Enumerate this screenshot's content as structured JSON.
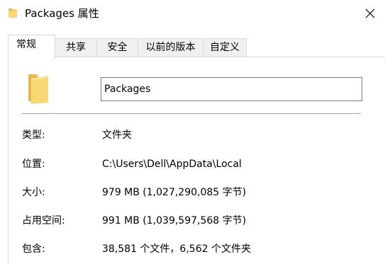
{
  "window": {
    "title": "Packages 属性",
    "close_glyph": "✕"
  },
  "tabs": [
    {
      "label": "常规",
      "active": true
    },
    {
      "label": "共享",
      "active": false
    },
    {
      "label": "安全",
      "active": false
    },
    {
      "label": "以前的版本",
      "active": false
    },
    {
      "label": "自定义",
      "active": false
    }
  ],
  "general": {
    "folder_name": "Packages",
    "type_label": "类型:",
    "type_value": "文件夹",
    "location_label": "位置:",
    "location_value": "C:\\Users\\Dell\\AppData\\Local",
    "size_label": "大小:",
    "size_value": "979 MB (1,027,290,085 字节)",
    "size_on_disk_label": "占用空间:",
    "size_on_disk_value": "991 MB (1,039,597,568 字节)",
    "contains_label": "包含:",
    "contains_value": "38,581 个文件，6,562 个文件夹"
  },
  "icons": {
    "title": "folder-icon",
    "close": "close-icon",
    "large_folder": "folder-icon"
  },
  "colors": {
    "folder_body": "#F8D775",
    "folder_back": "#E7B84A",
    "tab_inactive_bg": "#F0F0F0",
    "border": "#D9D9D9"
  }
}
